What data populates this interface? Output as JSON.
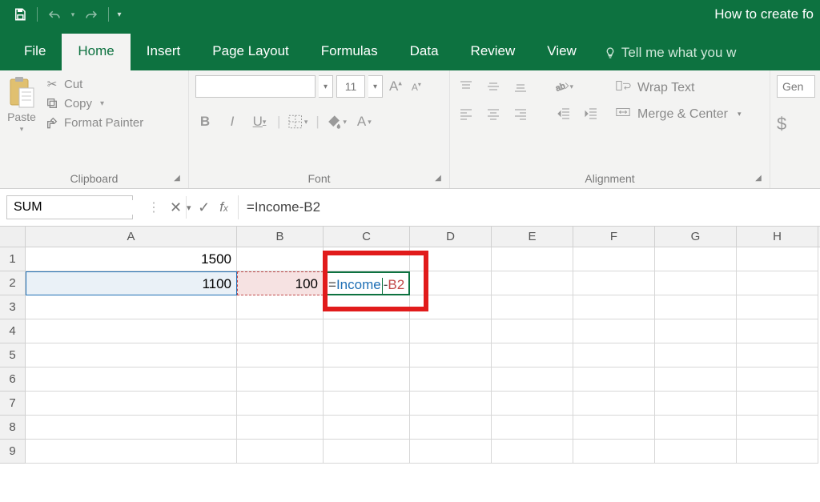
{
  "titlebar": {
    "document_title": "How to create fo"
  },
  "qat": {
    "save_tip": "Save",
    "undo_tip": "Undo",
    "redo_tip": "Redo"
  },
  "tabs": {
    "file": "File",
    "home": "Home",
    "insert": "Insert",
    "page_layout": "Page Layout",
    "formulas": "Formulas",
    "data": "Data",
    "review": "Review",
    "view": "View",
    "tell_me": "Tell me what you w"
  },
  "ribbon": {
    "clipboard": {
      "label": "Clipboard",
      "paste": "Paste",
      "cut": "Cut",
      "copy": "Copy",
      "format_painter": "Format Painter"
    },
    "font": {
      "label": "Font",
      "font_name": "",
      "font_size": "11",
      "bold": "B",
      "italic": "I",
      "underline": "U",
      "font_color": "A"
    },
    "alignment": {
      "label": "Alignment",
      "wrap_text": "Wrap Text",
      "merge_center": "Merge & Center"
    },
    "number": {
      "format": "Gen"
    }
  },
  "fx": {
    "namebox_value": "SUM",
    "formula_text": "=Income-B2"
  },
  "grid": {
    "columns": [
      "A",
      "B",
      "C",
      "D",
      "E",
      "F",
      "G",
      "H"
    ],
    "rows_shown": 9,
    "cells": {
      "A1": "1500",
      "A2": "1100",
      "B2": "100",
      "C2_formula_parts": {
        "eq": "=",
        "name": "Income",
        "dash": "-",
        "ref": "B2"
      }
    }
  }
}
